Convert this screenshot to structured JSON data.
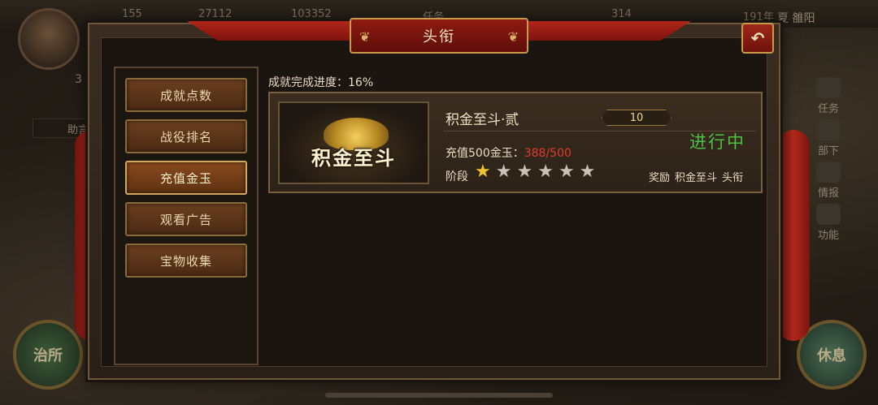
{
  "hud": {
    "resources": [
      "155",
      "27112",
      "103352",
      "任务",
      "314",
      "191年"
    ],
    "location": "夏 雒阳",
    "level": "3",
    "helper_label": "助言",
    "left_round_label": "治所",
    "right_round_label": "休息",
    "right_menu": [
      "任务",
      "部下",
      "情报",
      "功能"
    ]
  },
  "dialog": {
    "title": "头衔",
    "back_icon": "back-arrow-icon"
  },
  "tabs": [
    {
      "label": "成就点数",
      "active": false
    },
    {
      "label": "战役排名",
      "active": false
    },
    {
      "label": "充值金玉",
      "active": true
    },
    {
      "label": "观看广告",
      "active": false
    },
    {
      "label": "宝物收集",
      "active": false
    }
  ],
  "progress": {
    "label": "成就完成进度：",
    "value": "16%"
  },
  "achievement": {
    "image_text": "积金至斗",
    "title": "积金至斗·贰",
    "level": "10",
    "requirement_label": "充值500金玉：",
    "requirement_value": "388/500",
    "status": "进行中",
    "stage_label": "阶段",
    "stars_total": 6,
    "stars_filled": 1,
    "reward_label": "奖励",
    "reward_name": "积金至斗",
    "reward_type": "头衔"
  },
  "colors": {
    "status_green": "#4dc244",
    "progress_red": "#e23a2c",
    "star_gold": "#f2c12e"
  }
}
